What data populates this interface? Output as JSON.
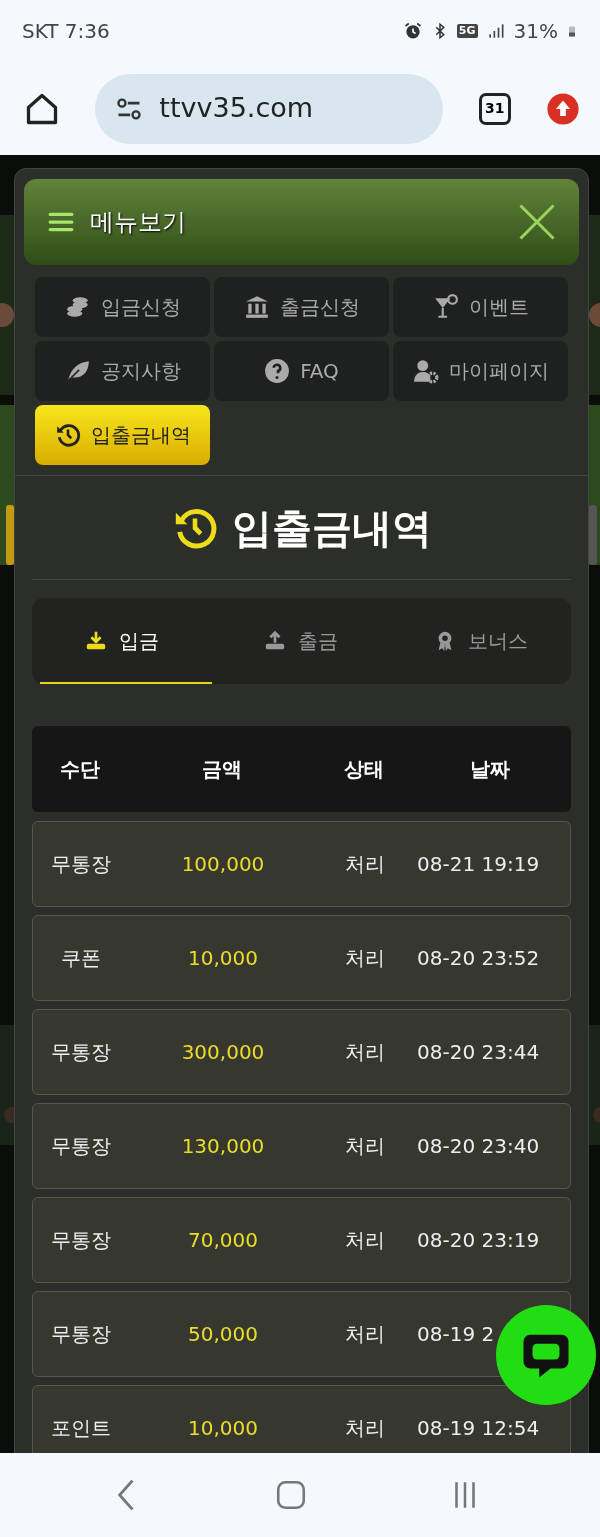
{
  "status_bar": {
    "carrier_time": "SKT 7:36",
    "network": "5G",
    "battery": "31%"
  },
  "browser": {
    "url": "ttvv35.com",
    "tab_count": "31"
  },
  "menu": {
    "title": "메뉴보기",
    "items": [
      {
        "label": "입금신청",
        "selected": false
      },
      {
        "label": "출금신청",
        "selected": false
      },
      {
        "label": "이벤트",
        "selected": false
      },
      {
        "label": "공지사항",
        "selected": false
      },
      {
        "label": "FAQ",
        "selected": false
      },
      {
        "label": "마이페이지",
        "selected": false
      },
      {
        "label": "입출금내역",
        "selected": true
      }
    ]
  },
  "section_title": "입출금내역",
  "tabs": [
    {
      "label": "입금",
      "selected": true
    },
    {
      "label": "출금",
      "selected": false
    },
    {
      "label": "보너스",
      "selected": false
    }
  ],
  "table": {
    "columns": [
      "수단",
      "금액",
      "상태",
      "날짜"
    ],
    "rows": [
      {
        "method": "무통장",
        "amount": "100,000",
        "status": "처리",
        "date": "08-21 19:19"
      },
      {
        "method": "쿠폰",
        "amount": "10,000",
        "status": "처리",
        "date": "08-20 23:52"
      },
      {
        "method": "무통장",
        "amount": "300,000",
        "status": "처리",
        "date": "08-20 23:44"
      },
      {
        "method": "무통장",
        "amount": "130,000",
        "status": "처리",
        "date": "08-20 23:40"
      },
      {
        "method": "무통장",
        "amount": "70,000",
        "status": "처리",
        "date": "08-20 23:19"
      },
      {
        "method": "무통장",
        "amount": "50,000",
        "status": "처리",
        "date": "08-19 2"
      },
      {
        "method": "포인트",
        "amount": "10,000",
        "status": "처리",
        "date": "08-19 12:54"
      }
    ]
  }
}
